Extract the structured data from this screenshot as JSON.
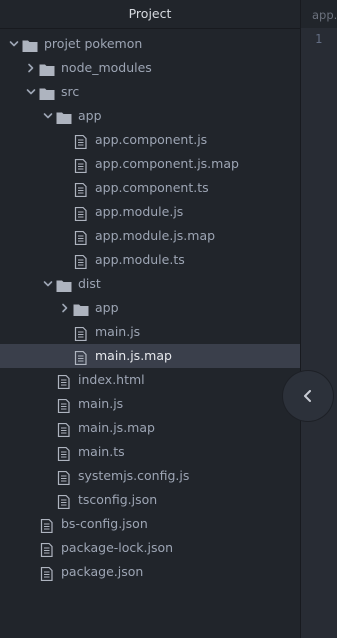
{
  "header": {
    "title": "Project"
  },
  "editor": {
    "tab_label": "app.",
    "line_number": "1"
  },
  "colors": {
    "folder": "#aeb4bf",
    "file": "#aeb4bf",
    "selected_row": "#3a3f4b"
  },
  "tree": {
    "items": [
      {
        "label": "projet pokemon",
        "type": "folder",
        "level": 0,
        "expanded": true
      },
      {
        "label": "node_modules",
        "type": "folder",
        "level": 1,
        "expanded": false
      },
      {
        "label": "src",
        "type": "folder",
        "level": 1,
        "expanded": true
      },
      {
        "label": "app",
        "type": "folder",
        "level": 2,
        "expanded": true
      },
      {
        "label": "app.component.js",
        "type": "file",
        "level": 3
      },
      {
        "label": "app.component.js.map",
        "type": "file",
        "level": 3
      },
      {
        "label": "app.component.ts",
        "type": "file",
        "level": 3
      },
      {
        "label": "app.module.js",
        "type": "file",
        "level": 3
      },
      {
        "label": "app.module.js.map",
        "type": "file",
        "level": 3
      },
      {
        "label": "app.module.ts",
        "type": "file",
        "level": 3
      },
      {
        "label": "dist",
        "type": "folder",
        "level": 2,
        "expanded": true
      },
      {
        "label": "app",
        "type": "folder",
        "level": 3,
        "expanded": false
      },
      {
        "label": "main.js",
        "type": "file",
        "level": 3
      },
      {
        "label": "main.js.map",
        "type": "file",
        "level": 3,
        "selected": true
      },
      {
        "label": "index.html",
        "type": "file",
        "level": 2
      },
      {
        "label": "main.js",
        "type": "file",
        "level": 2
      },
      {
        "label": "main.js.map",
        "type": "file",
        "level": 2
      },
      {
        "label": "main.ts",
        "type": "file",
        "level": 2
      },
      {
        "label": "systemjs.config.js",
        "type": "file",
        "level": 2
      },
      {
        "label": "tsconfig.json",
        "type": "file",
        "level": 2
      },
      {
        "label": "bs-config.json",
        "type": "file",
        "level": 1
      },
      {
        "label": "package-lock.json",
        "type": "file",
        "level": 1
      },
      {
        "label": "package.json",
        "type": "file",
        "level": 1
      }
    ]
  }
}
